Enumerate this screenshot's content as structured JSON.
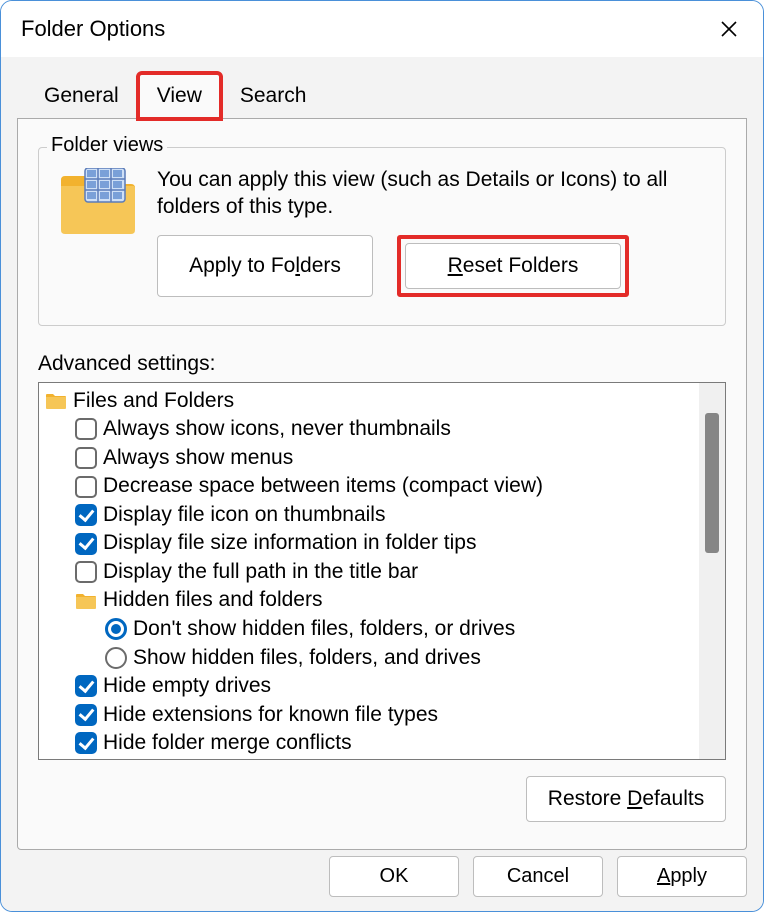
{
  "window": {
    "title": "Folder Options"
  },
  "tabs": {
    "general": "General",
    "view": "View",
    "search": "Search"
  },
  "folderViews": {
    "legend": "Folder views",
    "description": "You can apply this view (such as Details or Icons) to all folders of this type.",
    "applyBtn": "Apply to Folders",
    "resetBtn": "Reset Folders"
  },
  "advanced": {
    "label": "Advanced settings:",
    "groupLabel": "Files and Folders",
    "items": {
      "alwaysIcons": "Always show icons, never thumbnails",
      "alwaysMenus": "Always show menus",
      "compactView": "Decrease space between items (compact view)",
      "iconOnThumb": "Display file icon on thumbnails",
      "sizeTips": "Display file size information in folder tips",
      "fullPath": "Display the full path in the title bar",
      "hiddenGroup": "Hidden files and folders",
      "dontShowHidden": "Don't show hidden files, folders, or drives",
      "showHidden": "Show hidden files, folders, and drives",
      "hideEmpty": "Hide empty drives",
      "hideExt": "Hide extensions for known file types",
      "hideMerge": "Hide folder merge conflicts"
    },
    "restoreBtn": "Restore Defaults"
  },
  "footer": {
    "ok": "OK",
    "cancel": "Cancel",
    "apply": "Apply"
  }
}
